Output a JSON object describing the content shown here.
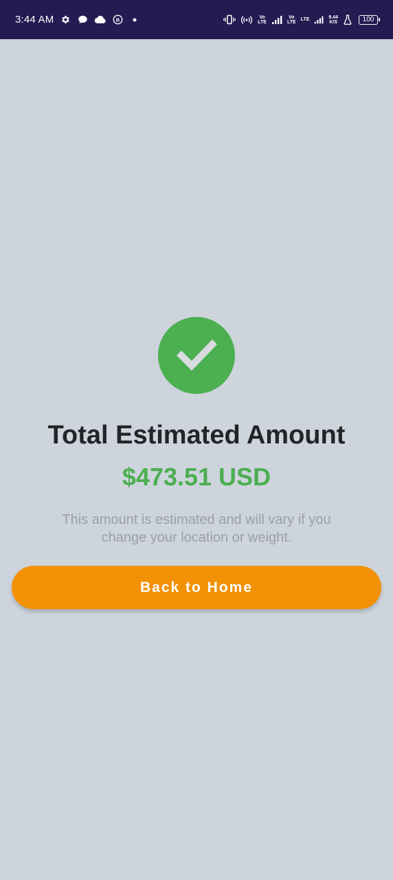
{
  "status_bar": {
    "time": "3:44 AM",
    "left_icons": [
      "settings-icon",
      "chat-bubble-icon",
      "cloud-icon",
      "b-badge-icon",
      "dot-icon"
    ],
    "vo_lte_1": {
      "top": "Vo",
      "bottom": "LTE"
    },
    "vo_lte_2": {
      "top": "Vo",
      "bottom": "LTE"
    },
    "lte_label": "LTE",
    "speed": {
      "value": "9.44",
      "unit": "K/S"
    },
    "battery": "100"
  },
  "main": {
    "title": "Total Estimated Amount",
    "amount": "$473.51 USD",
    "note": "This amount is estimated and will vary if you change your location or weight.",
    "button_label": "Back to Home"
  },
  "colors": {
    "background": "#cdd4dc",
    "status_bar": "#241b52",
    "success": "#4caf50",
    "button": "#f39106",
    "title": "#222427",
    "note": "#9aa0a6"
  }
}
